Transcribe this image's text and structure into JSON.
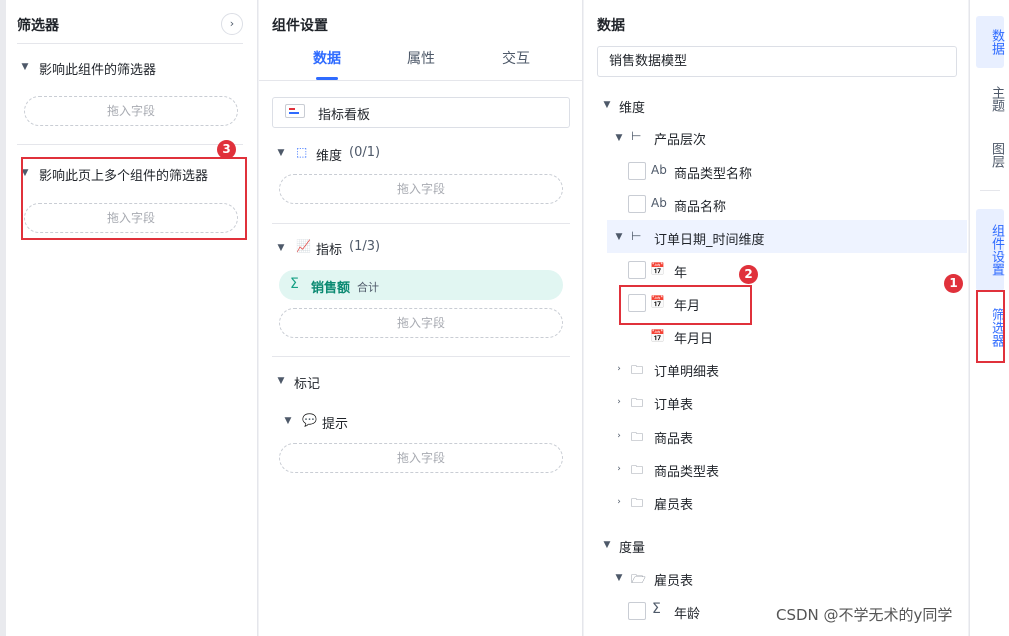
{
  "filter_panel": {
    "title": "筛选器",
    "collapse_icon": "›",
    "group1": {
      "label": "影响此组件的筛选器",
      "dropzone": "拖入字段"
    },
    "group2": {
      "label": "影响此页上多个组件的筛选器",
      "dropzone": "拖入字段"
    }
  },
  "settings_panel": {
    "title": "组件设置",
    "tabs": [
      "数据",
      "属性",
      "交互"
    ],
    "kanban": "指标看板",
    "dimension": {
      "label": "维度",
      "count": "(0/1)",
      "dropzone": "拖入字段"
    },
    "metric": {
      "label": "指标",
      "count": "(1/3)",
      "item": "销售额",
      "agg": "合计",
      "dropzone": "拖入字段"
    },
    "marks": {
      "label": "标记",
      "tooltip": "提示",
      "dropzone": "拖入字段"
    }
  },
  "data_panel": {
    "title": "数据",
    "model": "销售数据模型",
    "dimensions_label": "维度",
    "product_hierarchy": "产品层次",
    "product_type_name": "商品类型名称",
    "product_name": "商品名称",
    "order_date": "订单日期_时间维度",
    "year": "年",
    "year_month": "年月",
    "year_month_day": "年月日",
    "tables": [
      "订单明细表",
      "订单表",
      "商品表",
      "商品类型表",
      "雇员表"
    ],
    "measures_label": "度量",
    "measure_table": "雇员表",
    "age": "年龄"
  },
  "rail": {
    "data": "数据",
    "theme": "主题",
    "layers": "图层",
    "settings": "组件设置",
    "filters": "筛选器"
  },
  "annotations": {
    "one": "1",
    "two": "2",
    "three": "3"
  },
  "watermark": "CSDN @不学无术的y同学",
  "colors": {
    "accent": "#2f6bff",
    "annotation": "#e0313b",
    "metric_bg": "#e1f6f2"
  }
}
